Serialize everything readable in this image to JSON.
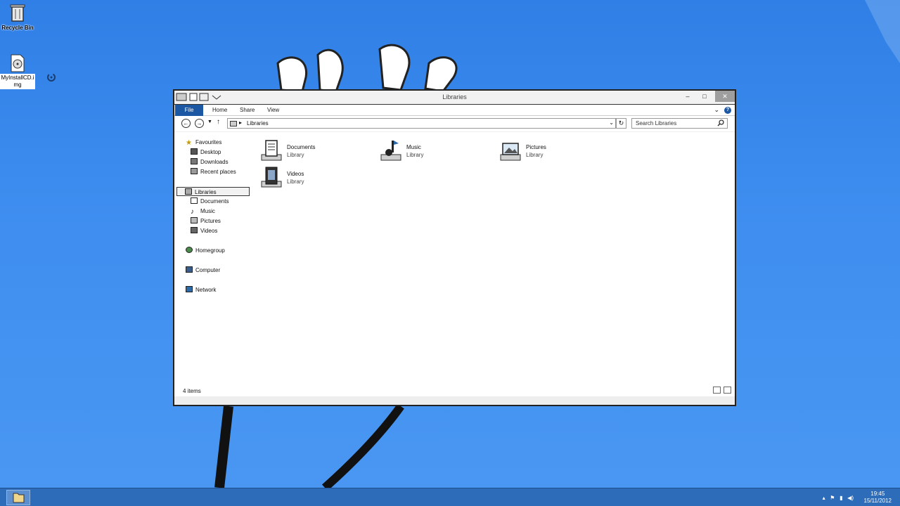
{
  "desktop": {
    "icons": [
      {
        "label": "Recycle Bin",
        "icon": "recycle-bin-icon"
      },
      {
        "label": "MyInstallCD.img",
        "icon": "disc-image-icon"
      }
    ]
  },
  "window": {
    "title": "Libraries",
    "ribbon_tabs": [
      "File",
      "Home",
      "Share",
      "View"
    ],
    "address": {
      "crumb": "Libraries"
    },
    "search": {
      "placeholder": "Search Libraries"
    },
    "nav": {
      "favourites": {
        "label": "Favourites",
        "items": [
          "Desktop",
          "Downloads",
          "Recent places"
        ]
      },
      "libraries": {
        "label": "Libraries",
        "items": [
          "Documents",
          "Music",
          "Pictures",
          "Videos"
        ]
      },
      "homegroup": "Homegroup",
      "computer": "Computer",
      "network": "Network"
    },
    "libraries": [
      {
        "name": "Documents",
        "type": "Library",
        "icon": "documents-library-icon"
      },
      {
        "name": "Music",
        "type": "Library",
        "icon": "music-library-icon"
      },
      {
        "name": "Pictures",
        "type": "Library",
        "icon": "pictures-library-icon"
      },
      {
        "name": "Videos",
        "type": "Library",
        "icon": "videos-library-icon"
      }
    ],
    "status": {
      "item_count": "4 items"
    }
  },
  "taskbar": {
    "clock": {
      "time": "19:45",
      "date": "15/11/2012"
    },
    "accent": "#2d6cb8"
  },
  "colors": {
    "desktop": "#3f8ef0",
    "file_tab": "#1c57a4"
  }
}
